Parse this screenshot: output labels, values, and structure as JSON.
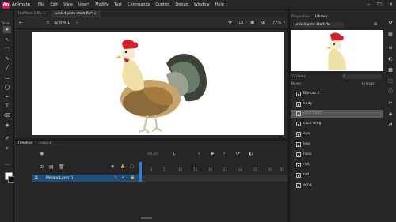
{
  "app": {
    "logo": "An",
    "name": "Animate"
  },
  "menu": [
    "File",
    "Edit",
    "View",
    "Insert",
    "Modify",
    "Text",
    "Commands",
    "Control",
    "Debug",
    "Window",
    "Help"
  ],
  "window_controls": [
    "–",
    "□",
    "✕"
  ],
  "doc_tabs": [
    {
      "label": "Untitled-1.fla ×",
      "active": false
    },
    {
      "label": "urok 4 pete start.fla* ×",
      "active": true
    }
  ],
  "scene": {
    "label": "Scene 1",
    "zoom": "77%"
  },
  "tools": {
    "title": "Tools"
  },
  "timeline": {
    "tabs": [
      "Timeline",
      "Output"
    ],
    "frame_readout": "00,00",
    "frame_number": "1",
    "ruler": [
      "1",
      "5",
      "10",
      "15",
      "20",
      "25",
      "30",
      "35",
      "40",
      "45"
    ],
    "layer_name": "MergedLayer_1"
  },
  "right_panel": {
    "tabs": [
      "Properties",
      "Library"
    ],
    "library_file": "urok 4 pete start.fla",
    "item_count": "13 items",
    "name_header": "Name",
    "linkage_header": "Linkage",
    "items": [
      {
        "label": "Bitmap 1",
        "selected": false
      },
      {
        "label": "body",
        "selected": false
      },
      {
        "label": "cock head",
        "selected": true
      },
      {
        "label": "cock wing",
        "selected": false
      },
      {
        "label": "eye",
        "selected": false
      },
      {
        "label": "legs",
        "selected": false
      },
      {
        "label": "neck",
        "selected": false
      },
      {
        "label": "red",
        "selected": false
      },
      {
        "label": "tail",
        "selected": false
      },
      {
        "label": "wing",
        "selected": false
      }
    ]
  },
  "colors": {
    "accent": "#2e7bd6",
    "brand": "#d4145a",
    "stage": "#ffffff"
  }
}
